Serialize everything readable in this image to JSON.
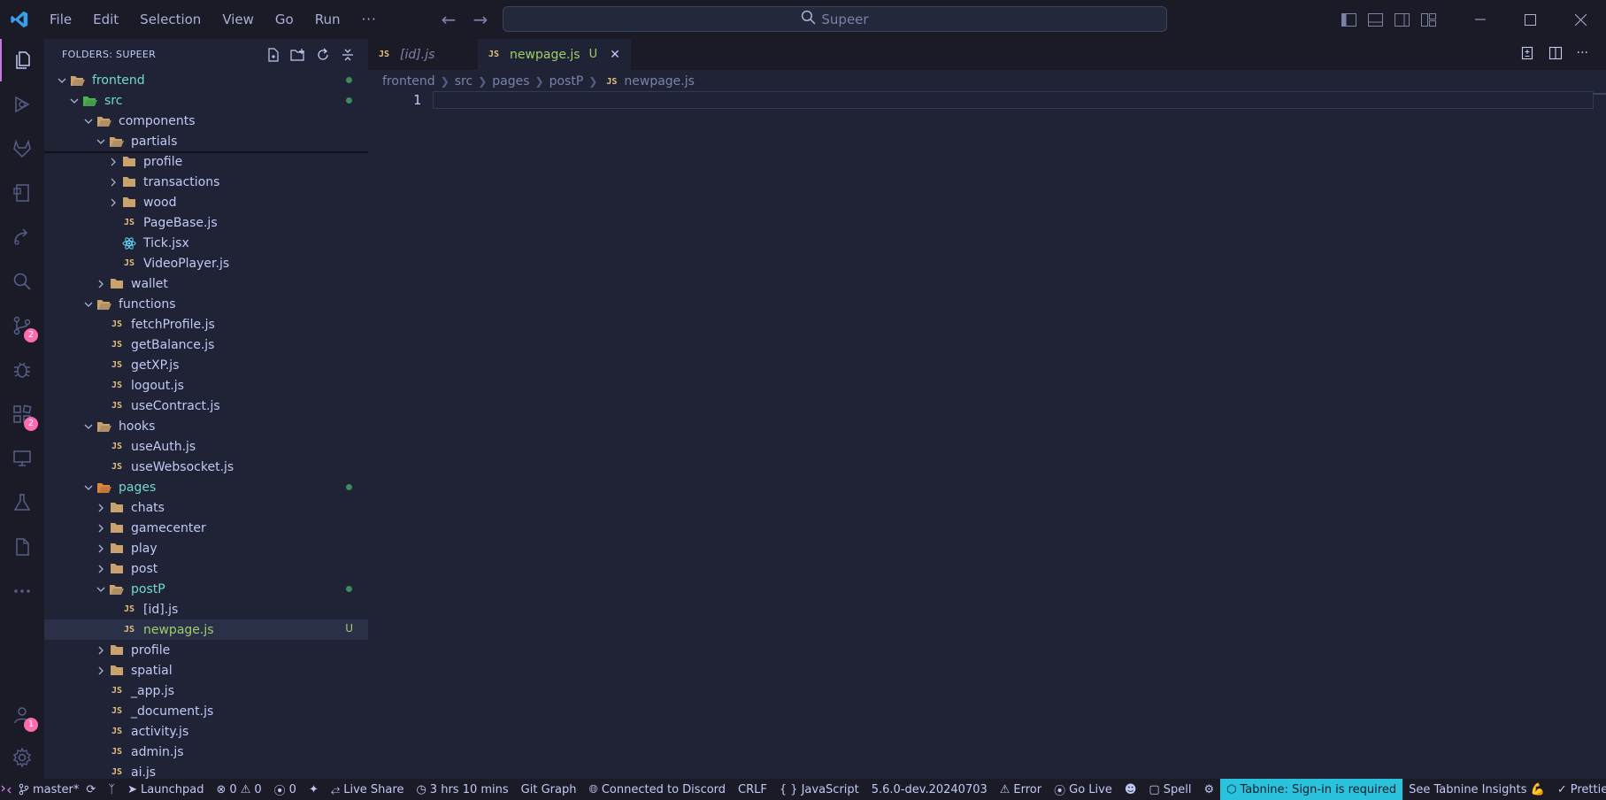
{
  "menu": {
    "items": [
      "File",
      "Edit",
      "Selection",
      "View",
      "Go",
      "Run"
    ],
    "more": "···"
  },
  "command_center": {
    "text": "Supeer"
  },
  "colors": {
    "accent": "#c678dd",
    "badge": "#ff6ab0",
    "tabnine": "#2ac3de",
    "git_added": "#9ece6a"
  },
  "activity": {
    "source_control_badge": "2",
    "extensions_badge": "2",
    "accounts_badge": "1"
  },
  "sidebar": {
    "title": "FOLDERS: SUPEER",
    "tree": [
      {
        "label": "frontend",
        "type": "folder-open",
        "depth": 0,
        "git": "modified"
      },
      {
        "label": "src",
        "type": "folder-open-src",
        "depth": 1,
        "git": "modified"
      },
      {
        "label": "components",
        "type": "folder-open",
        "depth": 2
      },
      {
        "label": "partials",
        "type": "folder-open",
        "depth": 3
      },
      {
        "label": "profile",
        "type": "folder",
        "depth": 4
      },
      {
        "label": "transactions",
        "type": "folder",
        "depth": 4
      },
      {
        "label": "wood",
        "type": "folder",
        "depth": 4
      },
      {
        "label": "PageBase.js",
        "type": "js",
        "depth": 4
      },
      {
        "label": "Tick.jsx",
        "type": "jsx",
        "depth": 4
      },
      {
        "label": "VideoPlayer.js",
        "type": "js",
        "depth": 4
      },
      {
        "label": "wallet",
        "type": "folder",
        "depth": 3
      },
      {
        "label": "functions",
        "type": "folder-open",
        "depth": 2
      },
      {
        "label": "fetchProfile.js",
        "type": "js",
        "depth": 3
      },
      {
        "label": "getBalance.js",
        "type": "js",
        "depth": 3
      },
      {
        "label": "getXP.js",
        "type": "js",
        "depth": 3
      },
      {
        "label": "logout.js",
        "type": "js",
        "depth": 3
      },
      {
        "label": "useContract.js",
        "type": "js",
        "depth": 3
      },
      {
        "label": "hooks",
        "type": "folder-open",
        "depth": 2
      },
      {
        "label": "useAuth.js",
        "type": "js",
        "depth": 3
      },
      {
        "label": "useWebsocket.js",
        "type": "js",
        "depth": 3
      },
      {
        "label": "pages",
        "type": "folder-open-pages",
        "depth": 2,
        "git": "modified"
      },
      {
        "label": "chats",
        "type": "folder",
        "depth": 3
      },
      {
        "label": "gamecenter",
        "type": "folder",
        "depth": 3
      },
      {
        "label": "play",
        "type": "folder",
        "depth": 3
      },
      {
        "label": "post",
        "type": "folder",
        "depth": 3
      },
      {
        "label": "postP",
        "type": "folder-open",
        "depth": 3,
        "git": "modified"
      },
      {
        "label": "[id].js",
        "type": "js",
        "depth": 4
      },
      {
        "label": "newpage.js",
        "type": "js",
        "depth": 4,
        "git": "untracked",
        "selected": true,
        "mark": "U"
      },
      {
        "label": "profile",
        "type": "folder",
        "depth": 3
      },
      {
        "label": "spatial",
        "type": "folder",
        "depth": 3
      },
      {
        "label": "_app.js",
        "type": "js",
        "depth": 3
      },
      {
        "label": "_document.js",
        "type": "js",
        "depth": 3
      },
      {
        "label": "activity.js",
        "type": "js",
        "depth": 3
      },
      {
        "label": "admin.js",
        "type": "js",
        "depth": 3
      },
      {
        "label": "ai.js",
        "type": "js",
        "depth": 3
      }
    ]
  },
  "tabs": [
    {
      "label": "[id].js",
      "active": false,
      "italic": true
    },
    {
      "label": "newpage.js",
      "active": true,
      "status": "U"
    }
  ],
  "breadcrumbs": [
    "frontend",
    "src",
    "pages",
    "postP",
    "newpage.js"
  ],
  "editor": {
    "line_numbers": [
      "1"
    ]
  },
  "statusbar": {
    "branch": "master*",
    "launchpad": "Launchpad",
    "errors": "0",
    "warnings": "0",
    "ports": "0",
    "live_share": "Live Share",
    "time": "3 hrs 10 mins",
    "git_graph": "Git Graph",
    "discord": "Connected to Discord",
    "eol": "CRLF",
    "language": "JavaScript",
    "version": "5.6.0-dev.20240703",
    "error_lens": "Error",
    "go_live": "Go Live",
    "spell": "Spell",
    "tabnine": "Tabnine: Sign-in is required",
    "tabnine_insights": "See Tabnine Insights 💪",
    "prettier": "Prettier"
  }
}
